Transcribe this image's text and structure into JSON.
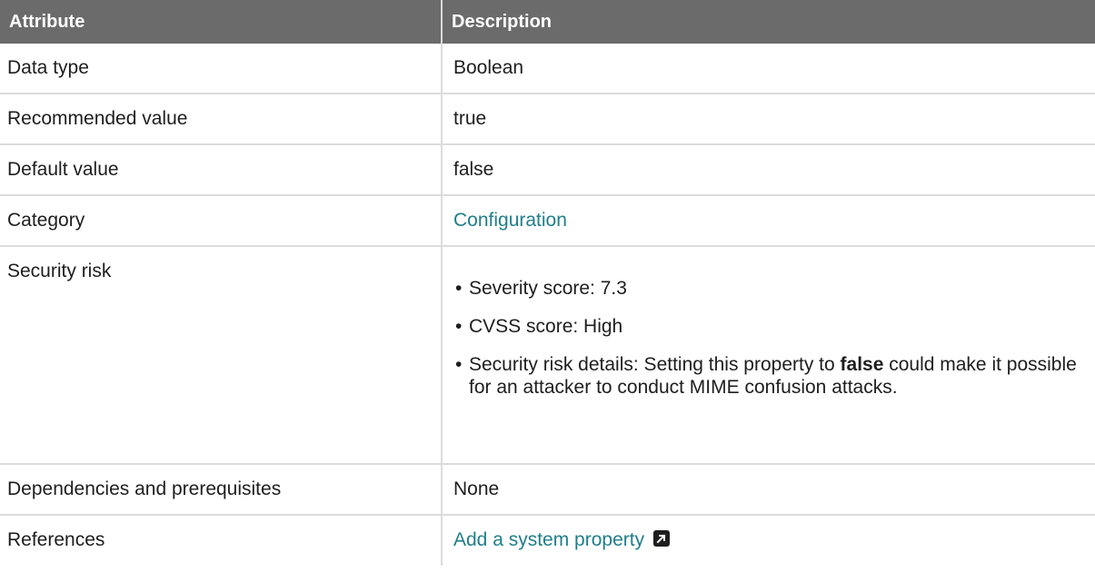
{
  "table": {
    "headers": {
      "attribute": "Attribute",
      "description": "Description"
    },
    "rows": [
      {
        "attribute": "Data type",
        "value": "Boolean"
      },
      {
        "attribute": "Recommended value",
        "value": "true"
      },
      {
        "attribute": "Default value",
        "value": "false"
      },
      {
        "attribute": "Category",
        "value": "Configuration"
      },
      {
        "attribute": "Security risk"
      },
      {
        "attribute": "Dependencies and prerequisites",
        "value": "None"
      },
      {
        "attribute": "References",
        "value": "Add a system property"
      }
    ],
    "security_risk": {
      "severity": "Severity score: 7.3",
      "cvss": "CVSS score: High",
      "details_prefix": "Security risk details: Setting this property to ",
      "details_keyword": "false",
      "details_suffix": " could make it possible for an attacker to conduct MIME confusion attacks."
    }
  },
  "colors": {
    "header_bg": "#6b6b6b",
    "link": "#1f7e8a",
    "border": "#dcdcdc"
  },
  "icons": {
    "external_link": "external-link-icon"
  }
}
